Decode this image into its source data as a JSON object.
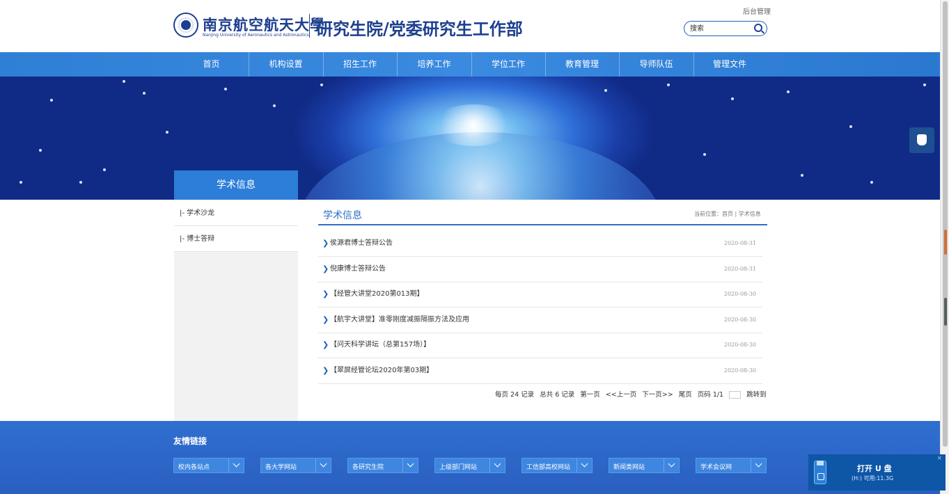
{
  "header": {
    "logo_cn": "南京航空航天大學",
    "logo_en": "Nanjing University of Aeronautics and Astronautics",
    "site_title": "研究生院/党委研究生工作部",
    "admin_link": "后台管理",
    "search_placeholder": "搜索"
  },
  "nav": {
    "items": [
      {
        "label": "首页"
      },
      {
        "label": "机构设置"
      },
      {
        "label": "招生工作"
      },
      {
        "label": "培养工作"
      },
      {
        "label": "学位工作"
      },
      {
        "label": "教育管理"
      },
      {
        "label": "导师队伍"
      },
      {
        "label": "管理文件"
      }
    ]
  },
  "sidebar": {
    "title": "学术信息",
    "items": [
      {
        "label": "|- 学术沙龙"
      },
      {
        "label": "|- 博士答辩"
      }
    ]
  },
  "main": {
    "title": "学术信息",
    "breadcrumb": {
      "prefix": "当前位置：",
      "home": "首页",
      "sep": "|",
      "current": "学术信息"
    },
    "news": [
      {
        "title": "侯源君博士答辩公告",
        "date": "2020-08-31"
      },
      {
        "title": "倪康博士答辩公告",
        "date": "2020-08-31"
      },
      {
        "title": "【经管大讲堂2020第013期】",
        "date": "2020-08-30"
      },
      {
        "title": "【航宇大讲堂】准零刚度减振隔振方法及应用",
        "date": "2020-08-30"
      },
      {
        "title": "【问天科学讲坛（总第157场）】",
        "date": "2020-08-30"
      },
      {
        "title": "【翠屏经管论坛2020年第03期】",
        "date": "2020-08-30"
      }
    ],
    "pager": {
      "per_page": "每页 24 记录",
      "total": "总共 6 记录",
      "first": "第一页",
      "prev": "<<上一页",
      "next": "下一页>>",
      "last": "尾页",
      "page_info": "页码 1/1",
      "jump": "跳转到"
    }
  },
  "footer": {
    "title": "友情链接",
    "links": [
      {
        "label": "校内各站点"
      },
      {
        "label": "各大学网站"
      },
      {
        "label": "各研究生院"
      },
      {
        "label": "上级部门网站"
      },
      {
        "label": "工信部高校网站"
      },
      {
        "label": "新闻类网站"
      },
      {
        "label": "学术会议网"
      }
    ]
  },
  "usb_toast": {
    "title": "打开 U 盘",
    "subtitle": "(H:)  可用:11.3G",
    "close": "×"
  },
  "colors": {
    "brand_blue": "#1d3f8f",
    "nav_blue": "#2f7fd6",
    "accent_blue": "#2c6fc4"
  }
}
